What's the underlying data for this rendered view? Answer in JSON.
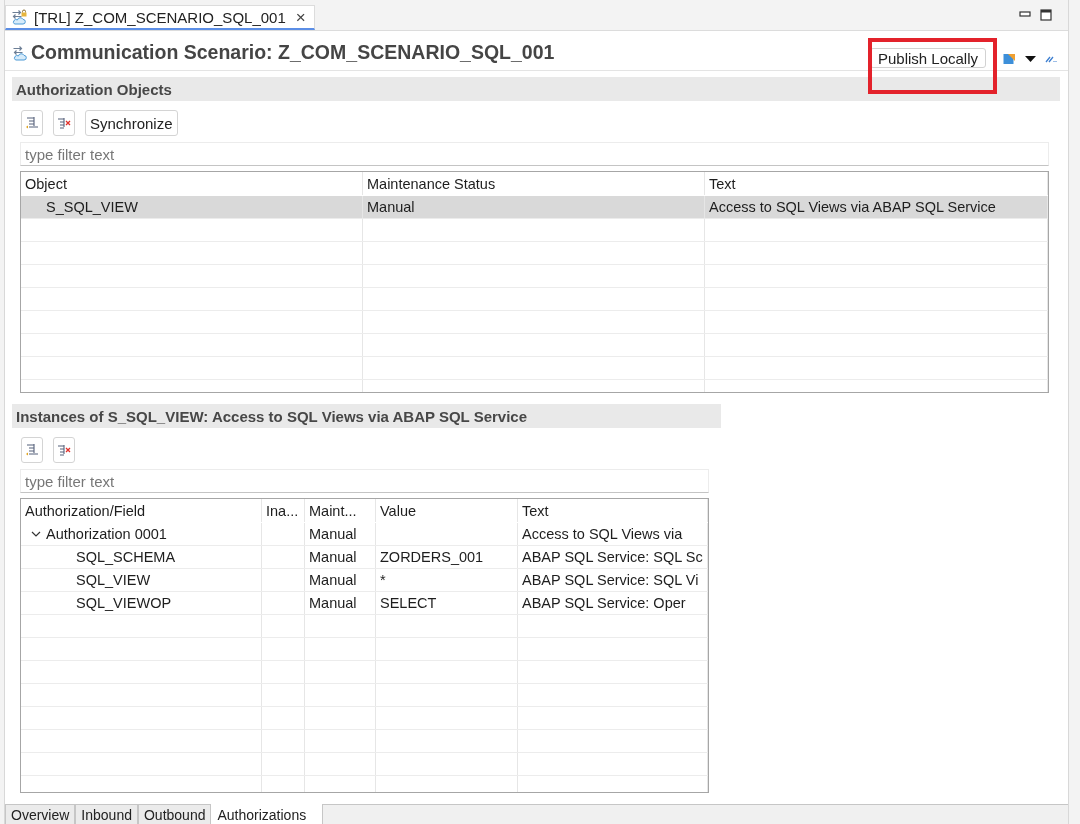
{
  "editor_tab": {
    "title": "[TRL] Z_COM_SCENARIO_SQL_001",
    "close_glyph": "×"
  },
  "header": {
    "title": "Communication Scenario: Z_COM_SCENARIO_SQL_001",
    "publish_button": {
      "label": "Publish Locally",
      "highlighted": true
    }
  },
  "authorization_objects": {
    "title": "Authorization Objects",
    "synchronize_button": "Synchronize",
    "filter": {
      "placeholder": "type filter text"
    },
    "table": {
      "columns": [
        "Object",
        "Maintenance Status",
        "Text"
      ],
      "rows": [
        {
          "object": "S_SQL_VIEW",
          "maintenance_status": "Manual",
          "text": "Access to SQL Views via ABAP SQL Service",
          "selected": true
        }
      ]
    }
  },
  "instances": {
    "title": "Instances of S_SQL_VIEW: Access to SQL Views via ABAP SQL Service",
    "filter": {
      "placeholder": "type filter text"
    },
    "table": {
      "columns": [
        "Authorization/Field",
        "Ina...",
        "Maint...",
        "Value",
        "Text"
      ],
      "rows": [
        {
          "field": "Authorization 0001",
          "maintenance": "Manual",
          "text": "Access to SQL Views via",
          "expanded": true,
          "children": [
            {
              "field": "SQL_SCHEMA",
              "maintenance": "Manual",
              "value": "ZORDERS_001",
              "text": "ABAP SQL Service: SQL Sc"
            },
            {
              "field": "SQL_VIEW",
              "maintenance": "Manual",
              "value": "*",
              "text": "ABAP SQL Service: SQL Vi"
            },
            {
              "field": "SQL_VIEWOP",
              "maintenance": "Manual",
              "value": "SELECT",
              "text": "ABAP SQL Service: Oper"
            }
          ]
        }
      ]
    }
  },
  "bottom_tabs": [
    {
      "label": "Overview",
      "selected": false
    },
    {
      "label": "Inbound",
      "selected": false
    },
    {
      "label": "Outbound",
      "selected": false
    },
    {
      "label": "Authorizations",
      "selected": true
    }
  ]
}
